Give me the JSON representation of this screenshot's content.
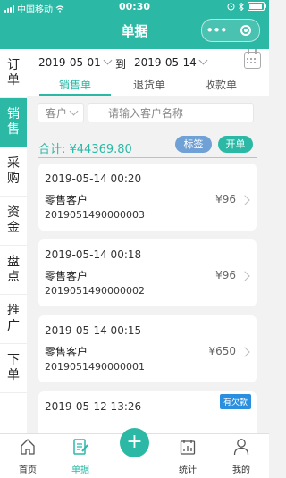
{
  "status": {
    "carrier": "中国移动",
    "time": "00:30"
  },
  "nav": {
    "title": "单据"
  },
  "sidebar": {
    "items": [
      {
        "label": "订单"
      },
      {
        "label": "销售"
      },
      {
        "label": "采购"
      },
      {
        "label": "资金"
      },
      {
        "label": "盘点"
      },
      {
        "label": "推广"
      },
      {
        "label": "下单"
      }
    ]
  },
  "filters": {
    "start_date": "2019-05-01",
    "to_label": "到",
    "end_date": "2019-05-14"
  },
  "tabs": [
    {
      "label": "销售单"
    },
    {
      "label": "退货单"
    },
    {
      "label": "收款单"
    }
  ],
  "search": {
    "customer_select": "客户",
    "placeholder": "请输入客户名称"
  },
  "summary": {
    "total": "合计: ¥44369.80",
    "tag_button": "标签",
    "open_button": "开单"
  },
  "orders": [
    {
      "datetime": "2019-05-14 00:20",
      "customer": "零售客户",
      "number": "2019051490000003",
      "amount": "¥96"
    },
    {
      "datetime": "2019-05-14 00:18",
      "customer": "零售客户",
      "number": "2019051490000002",
      "amount": "¥96"
    },
    {
      "datetime": "2019-05-14 00:15",
      "customer": "零售客户",
      "number": "2019051490000001",
      "amount": "¥650"
    },
    {
      "datetime": "2019-05-12 13:26",
      "badge": "有欠款"
    }
  ],
  "tabbar": [
    {
      "label": "首页",
      "icon": "home-icon"
    },
    {
      "label": "单据",
      "icon": "document-edit-icon"
    },
    {
      "label": "",
      "icon": "plus-icon"
    },
    {
      "label": "统计",
      "icon": "calendar-stats-icon"
    },
    {
      "label": "我的",
      "icon": "user-icon"
    }
  ],
  "colors": {
    "accent": "#2bb8a5",
    "tag": "#6fa0d6",
    "debt_badge": "#2b8fe0"
  }
}
